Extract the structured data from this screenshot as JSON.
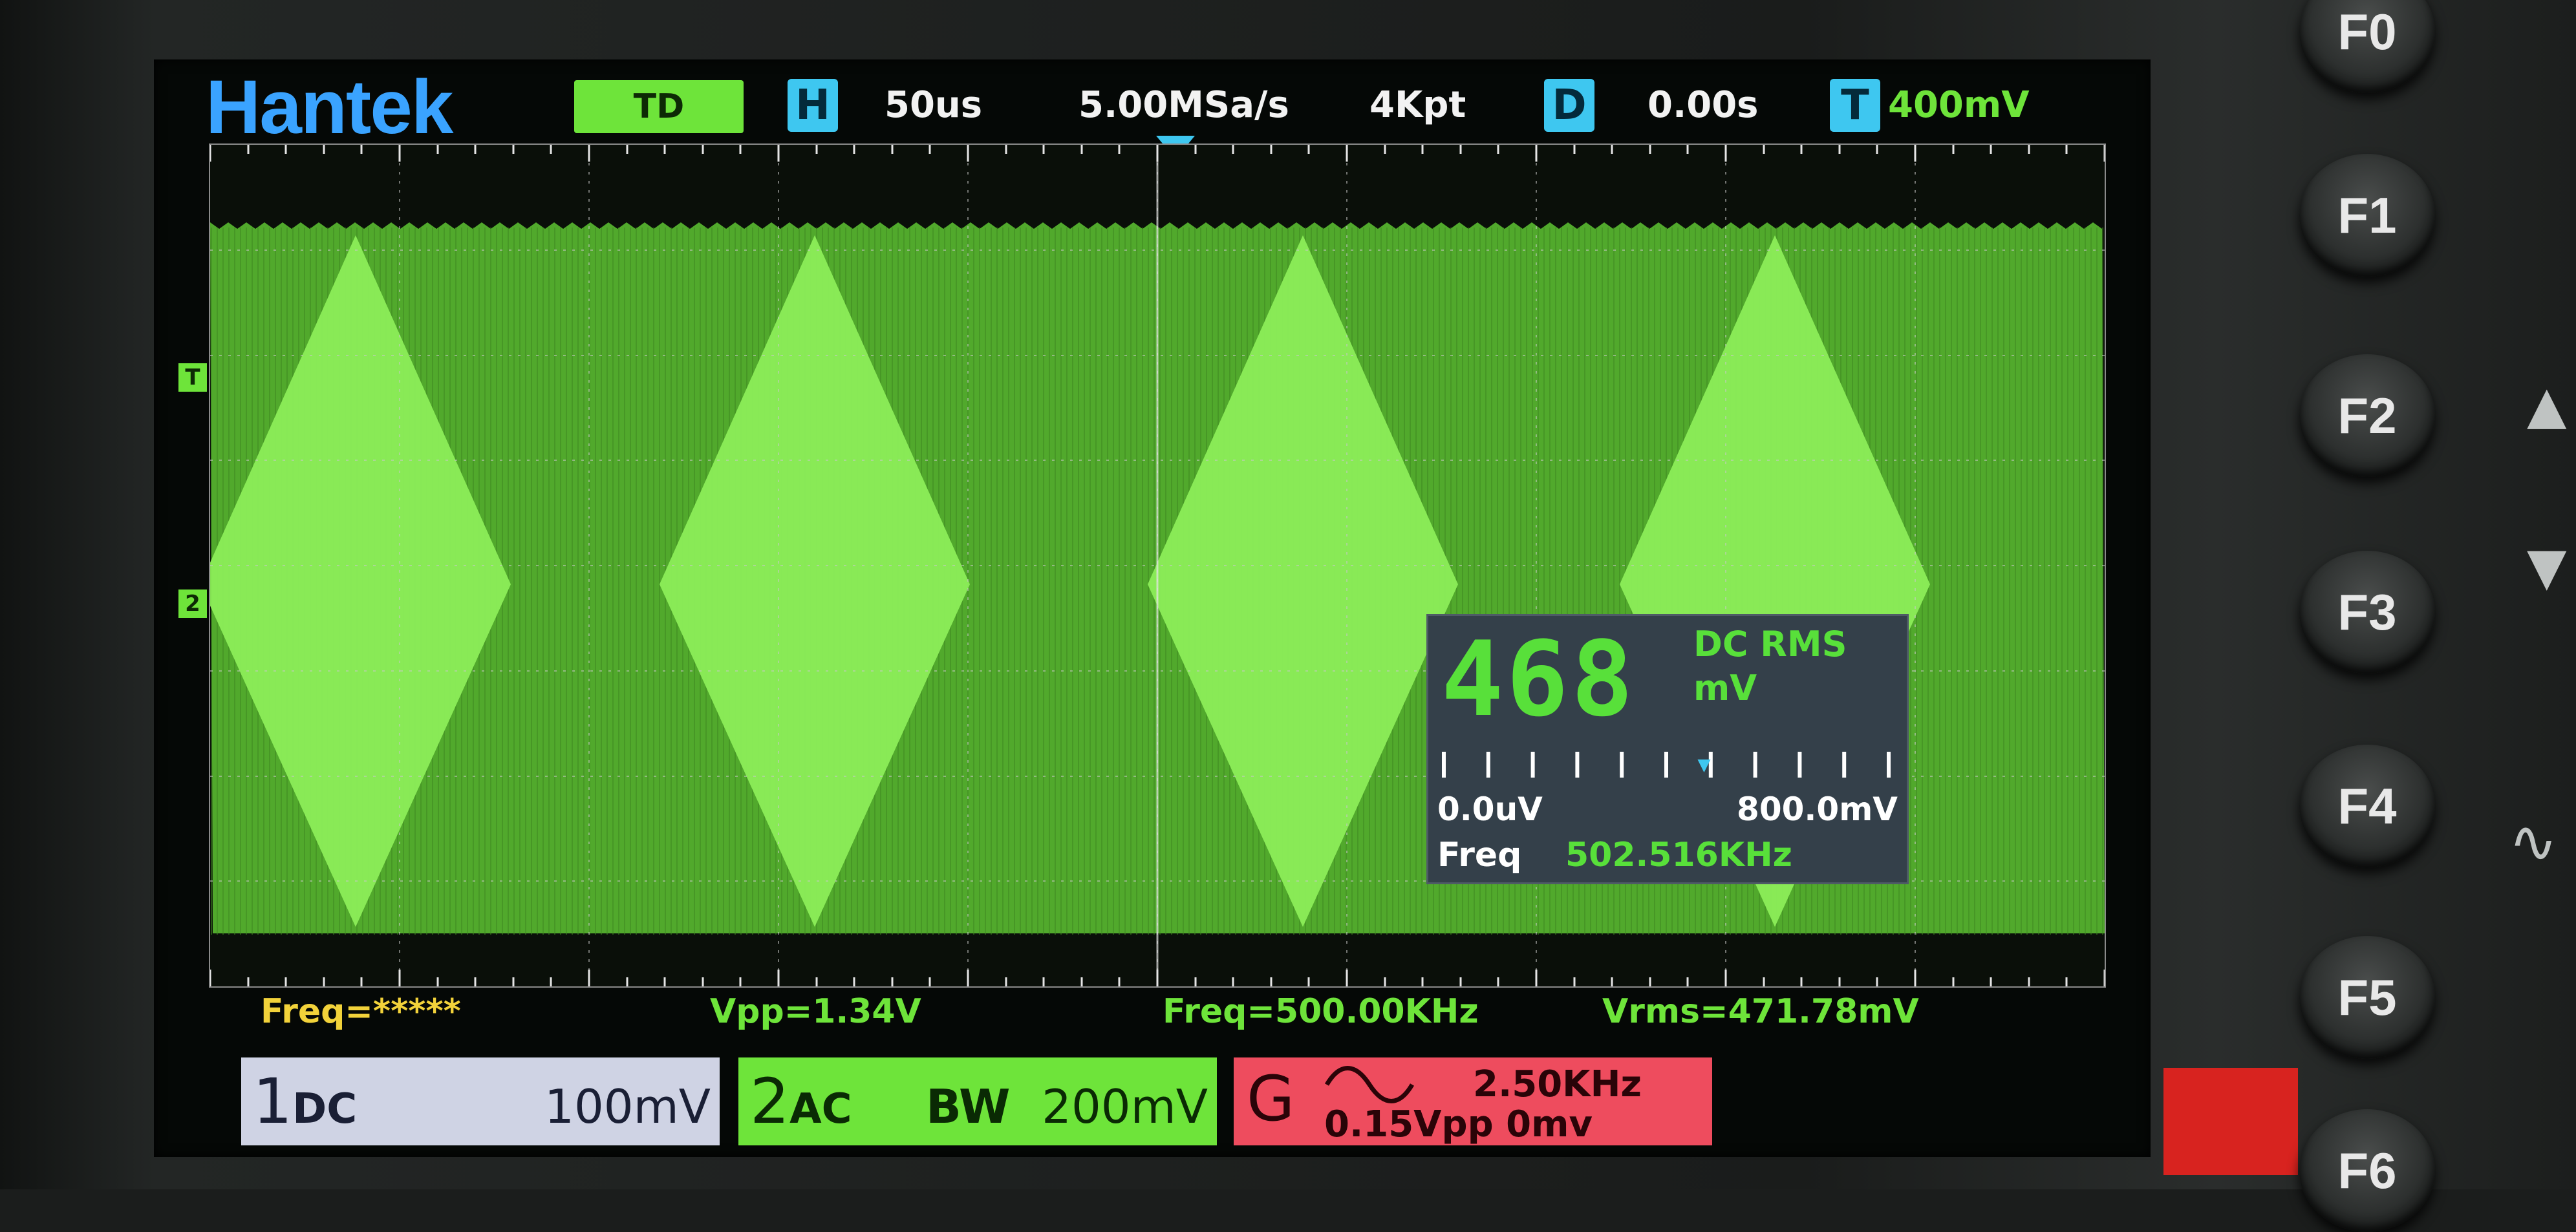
{
  "brand": "Hantek",
  "topbar": {
    "mode": "TD",
    "h_icon": "H",
    "timebase": "50us",
    "sample_rate": "5.00MSa/s",
    "memory_depth": "4Kpt",
    "d_icon": "D",
    "delay": "0.00s",
    "t_icon": "T",
    "trigger_level": "400mV"
  },
  "markers": {
    "trigger": "T",
    "channel2": "2"
  },
  "measurements": {
    "freq1": "Freq=*****",
    "vpp": "Vpp=1.34V",
    "freq2": "Freq=500.00KHz",
    "vrms": "Vrms=471.78mV"
  },
  "meter": {
    "reading": "468",
    "mode": "DC RMS",
    "unit": "mV",
    "range_low": "0.0uV",
    "range_high": "800.0mV",
    "freq_label": "Freq",
    "freq_value": "502.516KHz",
    "needle_fraction": 0.585
  },
  "channels": {
    "ch1": {
      "number": "1",
      "coupling": "DC",
      "scale": "100mV"
    },
    "ch2": {
      "number": "2",
      "coupling": "AC",
      "bw": "BW",
      "scale": "200mV"
    }
  },
  "generator": {
    "label": "G",
    "waveform_icon": "sine-icon",
    "frequency": "2.50KHz",
    "amplitude": "0.15Vpp  0mv"
  },
  "buttons": [
    "F0",
    "F1",
    "F2",
    "F3",
    "F4",
    "F5",
    "F6"
  ],
  "colors": {
    "trace": "#6ee43a",
    "accent": "#3ec7f0",
    "brand": "#3aa3ff",
    "generator": "#ee4c5e",
    "measure": "#f2d23a"
  }
}
